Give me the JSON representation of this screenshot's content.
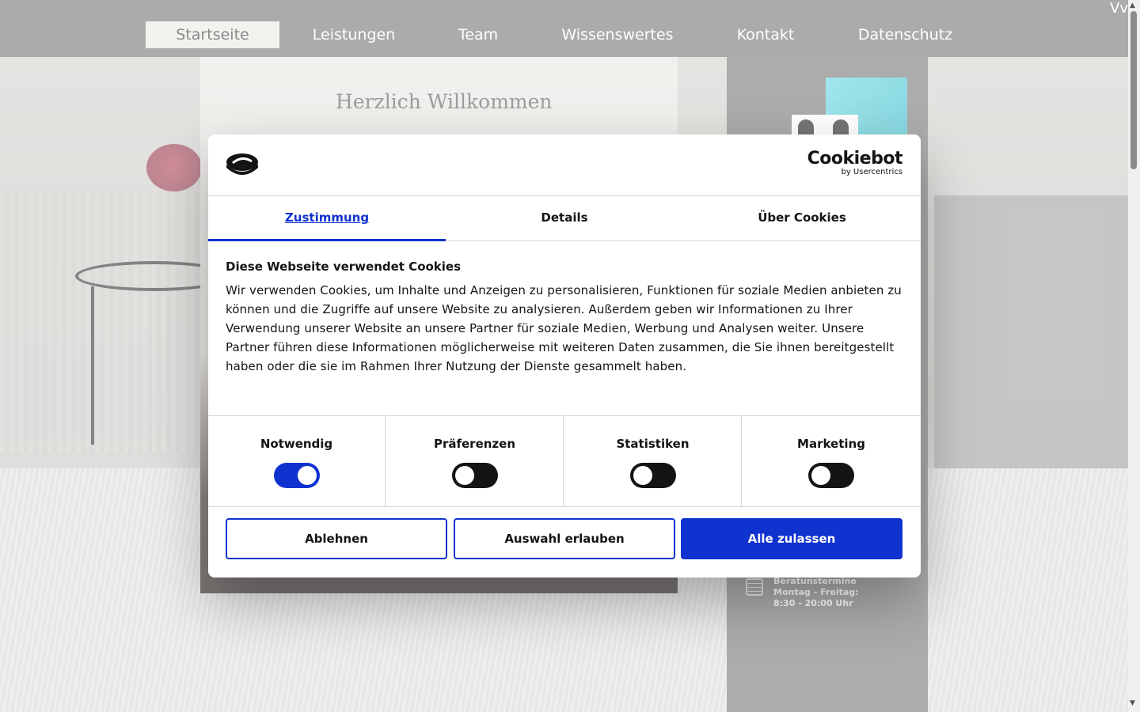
{
  "nav": {
    "items": [
      {
        "label": "Startseite",
        "active": true
      },
      {
        "label": "Leistungen",
        "active": false
      },
      {
        "label": "Team",
        "active": false
      },
      {
        "label": "Wissenswertes",
        "active": false
      },
      {
        "label": "Kontakt",
        "active": false
      },
      {
        "label": "Datenschutz",
        "active": false
      }
    ],
    "corner_text": "Vv"
  },
  "page": {
    "welcome": "Herzlich Willkommen",
    "hours": {
      "line1": "Beratunstermine",
      "line2": "Montag - Freitag:",
      "line3": "8:30 - 20:00 Uhr"
    }
  },
  "dialog": {
    "brand": {
      "name": "Cookiebot",
      "sub": "by Usercentrics"
    },
    "tabs": [
      {
        "label": "Zustimmung",
        "active": true
      },
      {
        "label": "Details",
        "active": false
      },
      {
        "label": "Über Cookies",
        "active": false
      }
    ],
    "title": "Diese Webseite verwendet Cookies",
    "text": "Wir verwenden Cookies, um Inhalte und Anzeigen zu personalisieren, Funktionen für soziale Medien anbieten zu können und die Zugriffe auf unsere Website zu analysieren. Außerdem geben wir Informationen zu Ihrer Verwendung unserer Website an unsere Partner für soziale Medien, Werbung und Analysen weiter. Unsere Partner führen diese Informationen möglicherweise mit weiteren Daten zusammen, die Sie ihnen bereitgestellt haben oder die sie im Rahmen Ihrer Nutzung der Dienste gesammelt haben.",
    "toggles": [
      {
        "label": "Notwendig",
        "on": true
      },
      {
        "label": "Präferenzen",
        "on": false
      },
      {
        "label": "Statistiken",
        "on": false
      },
      {
        "label": "Marketing",
        "on": false
      }
    ],
    "buttons": {
      "decline": "Ablehnen",
      "allow_selection": "Auswahl erlauben",
      "allow_all": "Alle zulassen"
    },
    "colors": {
      "accent": "#1032cf",
      "text": "#141414"
    }
  }
}
